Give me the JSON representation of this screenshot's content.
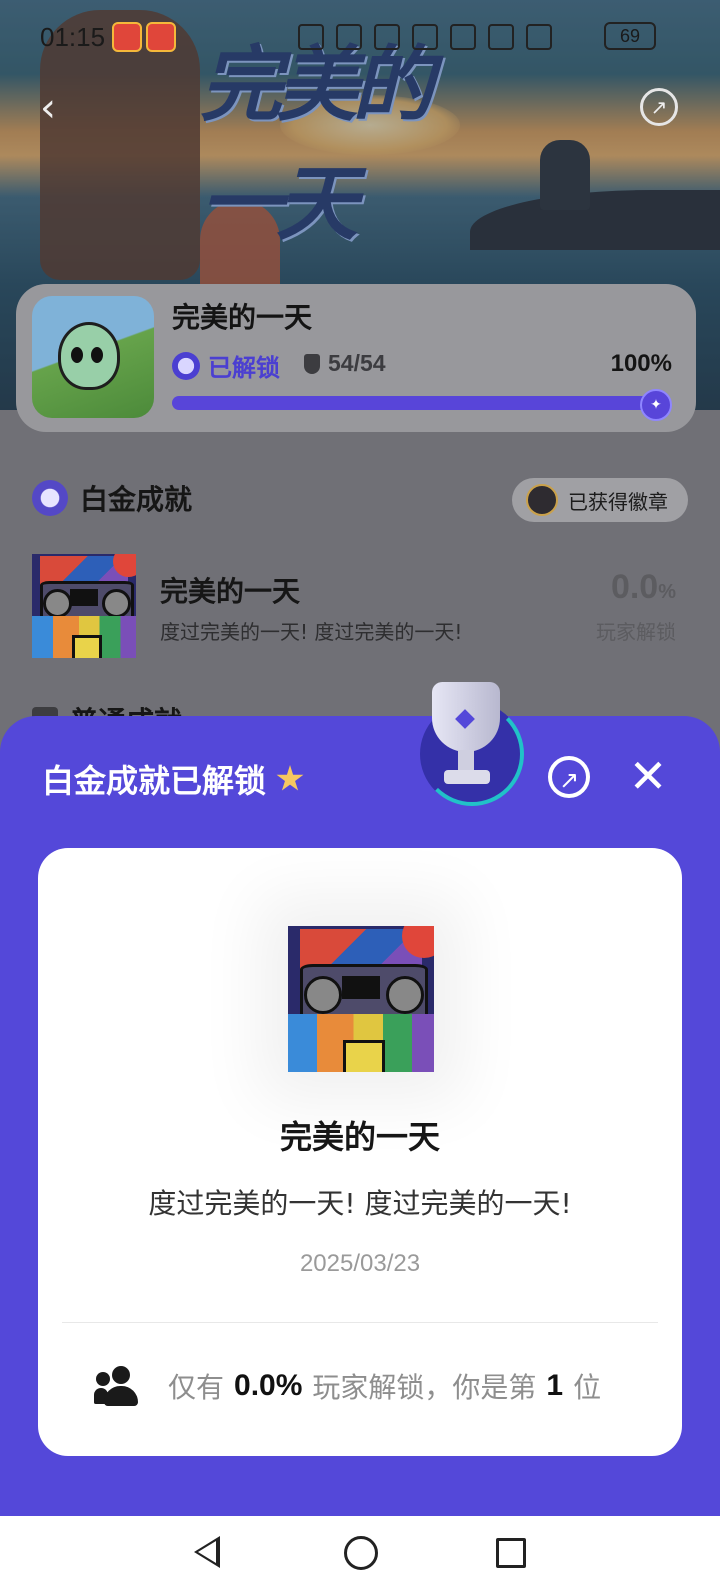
{
  "status_bar": {
    "time": "01:15",
    "battery": "69"
  },
  "game": {
    "name": "完美的一天",
    "unlock_status": "已解锁",
    "trophy_count": "54/54",
    "progress_percent": "100%",
    "progress_value": 1.0
  },
  "achievements": {
    "platinum_section_title": "白金成就",
    "badge_button_label": "已获得徽章",
    "items": [
      {
        "title": "完美的一天",
        "desc": "度过完美的一天! 度过完美的一天!",
        "pct": "0.0",
        "pct_unit": "%",
        "pct_label": "玩家解锁"
      }
    ],
    "normal_section_title": "普通成就"
  },
  "sheet": {
    "title": "白金成就已解锁",
    "achievement_title": "完美的一天",
    "achievement_desc": "度过完美的一天! 度过完美的一天!",
    "date": "2025/03/23",
    "stat_prefix": "仅有",
    "stat_pct": "0.0%",
    "stat_middle": "玩家解锁，你是第",
    "stat_rank": "1",
    "stat_suffix": "位"
  },
  "colors": {
    "accent": "#5448d9",
    "progress": "#5845d9"
  }
}
